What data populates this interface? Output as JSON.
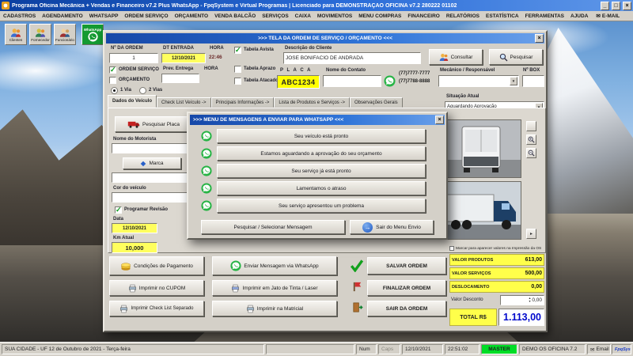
{
  "icons": {
    "close": "×",
    "minimize": "_",
    "maximize": "□",
    "envelope": "✉",
    "arrow_right": "→",
    "small_arrow": "▸",
    "dropdown": "▼",
    "spin_up": "▲",
    "spin_down": "▼"
  },
  "titlebar": {
    "title": "Programa Oficina Mecânica + Vendas e Financeiro v7.2 Plus WhatsApp - FpqSystem e Virtual Programas | Licenciado para DEMONSTRAÇÃO OFICINA v7.2 280222 01102"
  },
  "menu": {
    "items": [
      "CADASTROS",
      "AGENDAMENTO",
      "WHATSAPP",
      "ORDEM SERVIÇO",
      "ORÇAMENTO",
      "VENDA BALCÃO",
      "SERVIÇOS",
      "CAIXA",
      "MOVIMENTOS",
      "MENU COMPRAS",
      "FINANCEIRO",
      "RELATÓRIOS",
      "ESTATÍSTICA",
      "FERRAMENTAS",
      "AJUDA",
      "E-MAIL"
    ]
  },
  "shortcuts": {
    "items": [
      "Clientes",
      "Fornecedor",
      "Funcionário"
    ],
    "whatsapp": "WhatsApp"
  },
  "order_window": {
    "title": ">>>  TELA DA ORDEM DE SERVIÇO / ORÇAMENTO  <<<",
    "header": {
      "num_ordem_label": "Nº DA ORDEM",
      "num_ordem_value": "1",
      "dt_entrada_label": "DT ENTRADA",
      "dt_entrada_value": "12/10/2021",
      "hora_label": "HORA",
      "hora_value": "22:46",
      "ordem_servico_label": "ORDEM SERVIÇO",
      "orcamento_label": "ORÇAMENTO",
      "via1_label": "1 Via",
      "via2_label": "2 Vias",
      "prev_entrega_label": "Prev. Entrega",
      "hora2_label": "HORA",
      "tabela_avista_label": "Tabela Avista",
      "tabela_aprazo_label": "Tabela Aprazo",
      "tabela_atacado_label": "Tabela Atacado",
      "descricao_label": "Descrição do Cliente",
      "descricao_value": "JOSE BONIFACIO DE ANDRADA",
      "consultar_label": "Consultar",
      "pesquisar_label": "Pesquisar",
      "placa_label": "P L A C A",
      "placa_value": "ABC1234",
      "contato_label": "Nome do Contato",
      "contato_value": "",
      "phone1": "(77)7777-7777",
      "phone2": "(77)7788-8888",
      "mecanico_label": "Mecânico / Responsável",
      "mecanico_value": "",
      "box_label": "Nº BOX",
      "box_value": ""
    },
    "tabs": [
      "Dados do Veículo",
      "Check List Veículo ->",
      "Principais Informações ->",
      "Lista de Produtos e Serviços ->",
      "Observações Gerais"
    ],
    "situacao": {
      "label": "Situação Atual",
      "value": "Aguardando Aprovação"
    },
    "vehicle": {
      "pesquisar_placa_label": "Pesquisar Placa",
      "motorista_label": "Nome do Motorista",
      "motorista_value": "",
      "marca_label": "Marca",
      "marca_value": "",
      "cor_label": "Cor do veículo",
      "cor_value": "",
      "revisao_label": "Programar Revisão",
      "data_label": "Data",
      "data_value": "12/10/2021",
      "km_label": "Km Atual",
      "km_value": "10,000"
    },
    "actions": {
      "condicoes": "Condições de Pagamento",
      "imprimir_cupom": "Imprimir no CUPOM",
      "imprimir_checklist": "Imprimir Check List Separado",
      "enviar_whatsapp": "Enviar Mensagem via WhatsApp",
      "imprimir_jato": "Imprimir em Jato de Tinta / Laser",
      "imprimir_matricial": "Imprimir na Matricial",
      "salvar": "SALVAR ORDEM",
      "finalizar": "FINALIZAR ORDEM",
      "sair": "SAIR DA ORDEM"
    },
    "totals": {
      "print_note": "Marcar para aparecer valores na Impressão da OS",
      "rows": [
        {
          "label": "VALOR PRODUTOS",
          "value": "613,00"
        },
        {
          "label": "VALOR SERVIÇOS",
          "value": "500,00"
        },
        {
          "label": "DESLOCAMENTO",
          "value": "0,00"
        }
      ],
      "desconto_label": "Valor Desconto",
      "desconto_value": "0,00",
      "total_label": "TOTAL R$",
      "total_value": "1.113,00"
    }
  },
  "whatsapp_modal": {
    "title": ">>> MENU DE MENSAGENS A ENVIAR PARA WHATSAPP <<<",
    "messages": [
      "Seu veículo está pronto",
      "Estamos aguardando a aprovação do seu orçamento",
      "Seu serviço já está pronto",
      "Lamentamos o atraso",
      "Seu serviço apresentou um problema"
    ],
    "pesquisar_label": "Pesquisar / Selecionar Mensagem",
    "sair_label": "Sair do Menu Envio"
  },
  "statusbar": {
    "location": "SUA CIDADE - UF 12 de Outubro de 2021 - Terça-feira",
    "num": "Num",
    "caps": "Caps",
    "date": "12/10/2021",
    "time": "22:51:02",
    "master": "MASTER",
    "license": "DEMO OS OFICINA 7.2",
    "email": "Email",
    "brand": "FpqSystem"
  },
  "colors": {
    "plate_bg": "#ffff00",
    "highlight_field_bg": "#ffff5e",
    "total_text": "#0008cc",
    "whatsapp_green": "#28b446",
    "master_bg": "#00dd26",
    "title_blue": "#2a6cd8"
  }
}
